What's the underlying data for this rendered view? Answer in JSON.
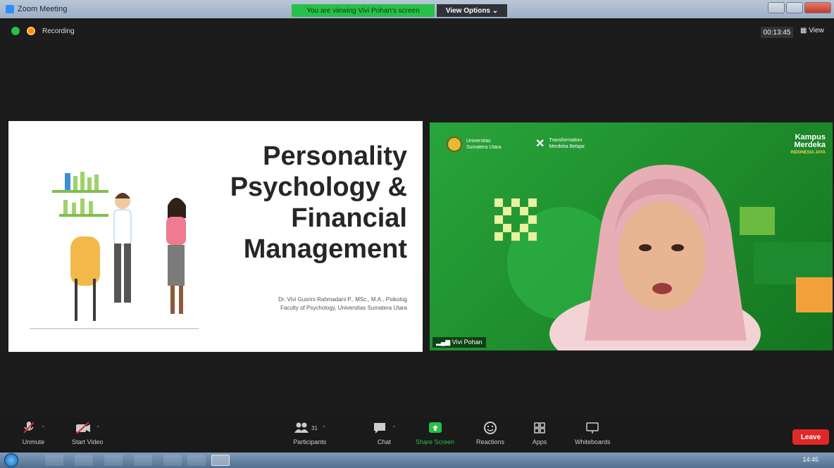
{
  "window": {
    "title": "Zoom Meeting",
    "viewing_banner": "You are viewing Vivi Pohan's screen",
    "view_options": "View Options ⌄"
  },
  "status": {
    "recording_label": "Recording",
    "timer": "00:13:45",
    "view_label": "View"
  },
  "slide": {
    "title_lines": [
      "Personality",
      "Psychology &",
      "Financial",
      "Management"
    ],
    "author_line1": "Dr. Vivi Gusrini Rahmadani P., MSc., M.A., Psikolog",
    "author_line2": "Faculty of Psychology, Universitas Sumatera Utara"
  },
  "video": {
    "participant_name": "Vivi Pohan",
    "logo_usu_line1": "Universitas",
    "logo_usu_line2": "Sumatera Utara",
    "logo_km_line1": "Transformation",
    "logo_km_line2": "Merdeka Belajar",
    "merdeka_line1": "Kampus",
    "merdeka_line2": "Merdeka",
    "merdeka_line3": "INDONESIA JAYA"
  },
  "toolbar": {
    "unmute": "Unmute",
    "start_video": "Start Video",
    "participants": "Participants",
    "participants_count": "31",
    "chat": "Chat",
    "share_screen": "Share Screen",
    "reactions": "Reactions",
    "apps": "Apps",
    "whiteboards": "Whiteboards",
    "leave": "Leave"
  },
  "taskbar": {
    "clock": "14:45"
  },
  "colors": {
    "zoom_green": "#27c048",
    "leave_red": "#e02828",
    "video_green": "#29a53b"
  }
}
